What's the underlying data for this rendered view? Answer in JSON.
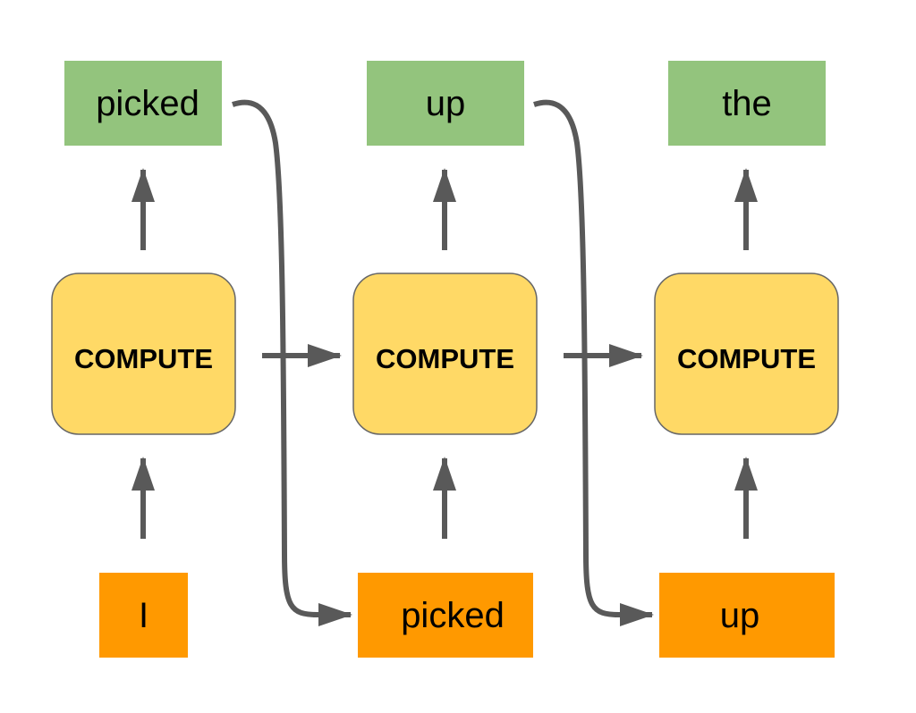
{
  "colors": {
    "output": "#93c47d",
    "compute": "#ffd966",
    "input": "#ff9900",
    "arrow": "#595959"
  },
  "steps": [
    {
      "output": "picked",
      "compute": "COMPUTE",
      "input": "I"
    },
    {
      "output": "up",
      "compute": "COMPUTE",
      "input": "picked"
    },
    {
      "output": "the",
      "compute": "COMPUTE",
      "input": "up"
    }
  ]
}
